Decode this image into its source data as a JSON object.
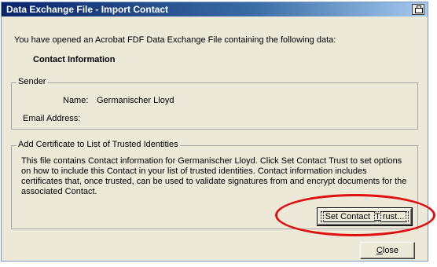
{
  "window": {
    "title": "Data Exchange File - Import Contact",
    "title_icon": "printer-icon"
  },
  "intro": "You have opened an Acrobat FDF Data Exchange File containing the following data:",
  "contact_section_title": "Contact Information",
  "sender": {
    "legend": "Sender",
    "name_label": "Name:",
    "name_value": "Germanischer Lloyd",
    "email_label": "Email Address:"
  },
  "certificate": {
    "legend": "Add Certificate to List of Trusted Identities",
    "description": "This file contains Contact information for Germanischer Lloyd. Click Set Contact Trust to set options on how to include this Contact in your list of trusted identities. Contact information includes certificates that, once trusted, can be used to validate signatures from and encrypt documents for the associated Contact."
  },
  "buttons": {
    "set_trust_pre": "Set Contact ",
    "set_trust_mnemonic": "T",
    "set_trust_post": "rust...",
    "close_mnemonic": "C",
    "close_post": "lose"
  },
  "colors": {
    "highlight_ellipse": "#e01010",
    "titlebar_start": "#0a246a"
  }
}
